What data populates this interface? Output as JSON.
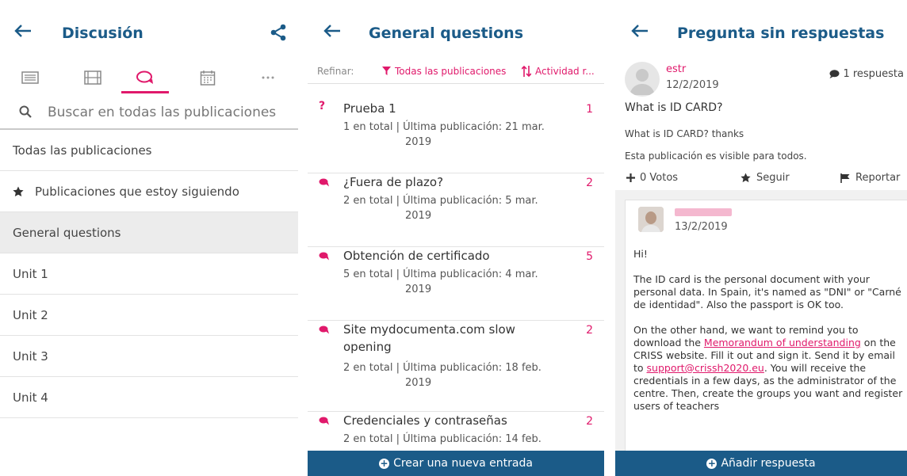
{
  "screen1": {
    "title": "Discusión",
    "tabs": [
      {
        "icon": "list-icon"
      },
      {
        "icon": "film-icon"
      },
      {
        "icon": "chat-icon"
      },
      {
        "icon": "calendar-icon"
      },
      {
        "icon": "more-icon"
      }
    ],
    "search_placeholder": "Buscar en todas las publicaciones",
    "filters": {
      "all": "Todas las publicaciones",
      "following": "Publicaciones que estoy siguiendo",
      "general": "General questions",
      "unit1": "Unit 1",
      "unit2": "Unit 2",
      "unit3": "Unit 3",
      "unit4": "Unit 4"
    }
  },
  "screen2": {
    "title": "General questions",
    "refine_label": "Refinar:",
    "filter_label": "Todas las publicaciones",
    "sort_label": "Actividad r...",
    "threads": [
      {
        "title": "Prueba 1",
        "count": "1",
        "meta": "1 en total | Última publicación: 21 mar.",
        "year": "2019",
        "icon": "question-icon"
      },
      {
        "title": "¿Fuera de plazo?",
        "count": "2",
        "meta": "2 en total | Última publicación: 5 mar.",
        "year": "2019",
        "icon": "chat-icon"
      },
      {
        "title": "Obtención de certificado",
        "count": "5",
        "meta": "5 en total | Última publicación: 4 mar.",
        "year": "2019",
        "icon": "chat-icon"
      },
      {
        "title": "Site mydocumenta.com slow opening",
        "count": "2",
        "meta": "2 en total | Última publicación: 18 feb.",
        "year": "2019",
        "icon": "chat-icon"
      },
      {
        "title": "Credenciales y contraseñas",
        "count": "2",
        "meta": "2 en total | Última publicación: 14 feb.",
        "year": "",
        "icon": "chat-icon"
      }
    ],
    "new_post": "Crear una nueva entrada"
  },
  "screen3": {
    "title": "Pregunta sin respuestas",
    "post": {
      "author": "estr",
      "date": "12/2/2019",
      "replies": "1 respuesta",
      "subject": "What is ID CARD?",
      "body": "What is ID CARD? thanks",
      "visibility": "Esta publicación es visible para todos."
    },
    "actions": {
      "votes": "0 Votos",
      "follow": "Seguir",
      "report": "Reportar"
    },
    "reply": {
      "date": "13/2/2019",
      "greeting": "Hi!",
      "para1": "The ID card is the personal document with your personal data. In Spain, it's named as \"DNI\" or \"Carné de identidad\". Also the passport is OK too.",
      "para2_a": "On the other hand, we want to remind you to download the ",
      "link1": "Memorandum of understanding",
      "para2_b": " on the CRISS website. Fill it out and sign it. Send it by email to ",
      "link2": "support@crissh2020.eu",
      "para2_c": ". You will receive the credentials in a few days, as the administrator of the centre. Then, create the groups you want and register users of teachers"
    },
    "add_reply": "Añadir respuesta"
  },
  "colors": {
    "brand_blue": "#1b5b88",
    "accent_pink": "#e0196b"
  }
}
